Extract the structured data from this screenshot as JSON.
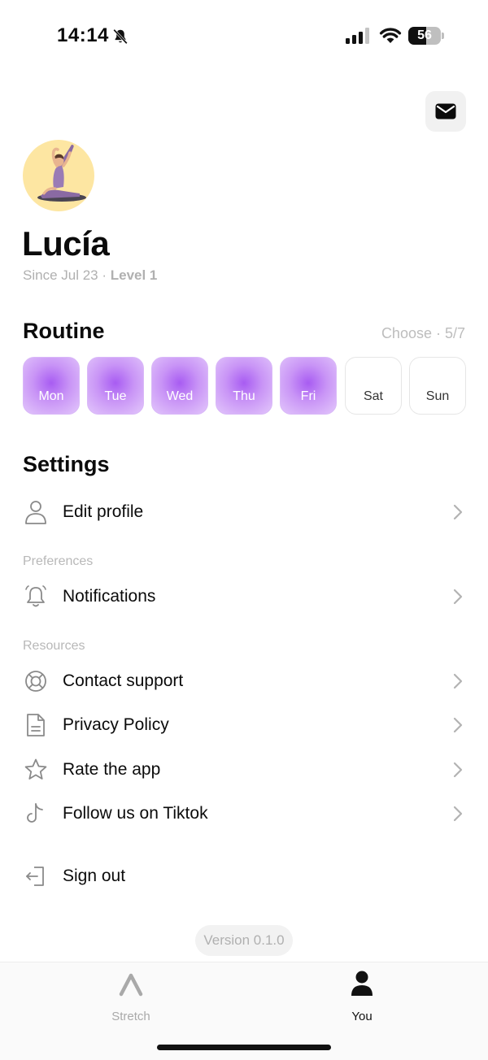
{
  "status_bar": {
    "time": "14:14",
    "battery_level": "56",
    "battery_fraction": 0.56,
    "icons": [
      "bell-off-icon",
      "signal-icon",
      "wifi-icon",
      "battery-icon"
    ]
  },
  "header": {
    "mail_icon": "mail-icon"
  },
  "profile": {
    "name": "Lucía",
    "since": "Since Jul 23",
    "separator": " · ",
    "level": "Level 1"
  },
  "routine": {
    "title": "Routine",
    "choose_label": "Choose · 5/7",
    "days": [
      {
        "label": "Mon",
        "selected": true
      },
      {
        "label": "Tue",
        "selected": true
      },
      {
        "label": "Wed",
        "selected": true
      },
      {
        "label": "Thu",
        "selected": true
      },
      {
        "label": "Fri",
        "selected": true
      },
      {
        "label": "Sat",
        "selected": false
      },
      {
        "label": "Sun",
        "selected": false
      }
    ],
    "accent_color": "#a85cf2"
  },
  "settings": {
    "title": "Settings",
    "edit_profile": "Edit profile",
    "preferences_label": "Preferences",
    "notifications": "Notifications",
    "resources_label": "Resources",
    "contact_support": "Contact support",
    "privacy_policy": "Privacy Policy",
    "rate_app": "Rate the app",
    "follow_tiktok": "Follow us on Tiktok",
    "sign_out": "Sign out"
  },
  "version": "Version 0.1.0",
  "tab_bar": {
    "stretch": "Stretch",
    "you": "You",
    "active_tab": "You"
  }
}
